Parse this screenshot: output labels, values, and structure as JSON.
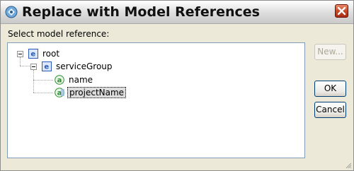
{
  "window": {
    "title": "Replace with Model References",
    "icons": {
      "app": "app-icon",
      "close": "close-icon"
    }
  },
  "prompt": "Select model reference:",
  "tree": {
    "nodes": [
      {
        "label": "root",
        "icon": "element-icon",
        "badge": "e",
        "expanded": true
      },
      {
        "label": "serviceGroup",
        "icon": "element-icon",
        "badge": "e",
        "expanded": true
      },
      {
        "label": "name",
        "icon": "attribute-icon",
        "badge": "a"
      },
      {
        "label": "projectName",
        "icon": "attribute-icon",
        "badge": "a",
        "selected": true
      }
    ]
  },
  "buttons": {
    "new": {
      "label": "New...",
      "enabled": false
    },
    "ok": {
      "label": "OK"
    },
    "cancel": {
      "label": "Cancel"
    }
  },
  "colors": {
    "element_badge": "#2b5cb8",
    "attribute_badge": "#2e8b2e",
    "close_button": "#c84a2a"
  }
}
